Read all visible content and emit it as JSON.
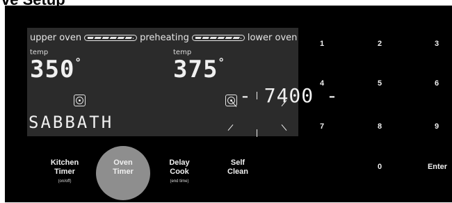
{
  "heading": "ve Setup",
  "display": {
    "upper_oven": "upper oven",
    "preheating": "preheating",
    "lower_oven": "lower oven",
    "temp_label_upper": "temp",
    "temp_label_lower": "temp",
    "upper_temp": "350",
    "lower_temp": "375",
    "degree": "°",
    "mode_text": "SABBATH",
    "clock": "- 7400 -"
  },
  "keypad": [
    "1",
    "2",
    "3",
    "4",
    "5",
    "6",
    "7",
    "8",
    "9",
    "0",
    "Enter"
  ],
  "buttons": {
    "kitchen_timer": {
      "line1": "Kitchen",
      "line2": "Timer",
      "sub": "(on/off)"
    },
    "oven_timer": {
      "line1": "Oven",
      "line2": "Timer"
    },
    "delay_cook": {
      "line1": "Delay",
      "line2": "Cook",
      "sub": "(end time)"
    },
    "self_clean": {
      "line1": "Self",
      "line2": "Clean"
    }
  }
}
